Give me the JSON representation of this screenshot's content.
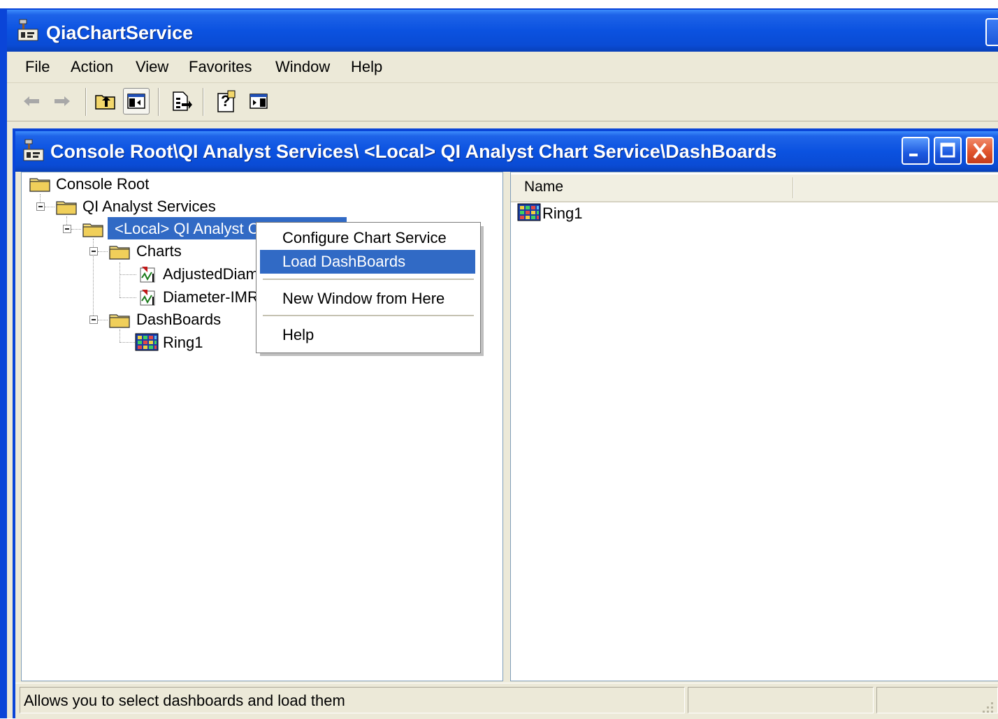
{
  "app": {
    "title": "QiaChartService"
  },
  "menu": [
    {
      "label": "File"
    },
    {
      "label": "Action"
    },
    {
      "label": "View"
    },
    {
      "label": "Favorites"
    },
    {
      "label": "Window"
    },
    {
      "label": "Help"
    }
  ],
  "toolbar": {
    "buttons": [
      "back-arrow-icon",
      "forward-arrow-icon",
      "up-folder-icon",
      "show-hide-tree-icon",
      "export-list-icon",
      "help-icon",
      "show-hide-action-pane-icon"
    ]
  },
  "inner_window": {
    "title": "Console Root\\QI Analyst Services\\ <Local> QI Analyst Chart Service\\DashBoards"
  },
  "tree": {
    "root": "Console Root",
    "services": "QI Analyst Services",
    "local": "<Local> QI Analyst C",
    "charts": "Charts",
    "chart_1": "AdjustedDiam",
    "chart_2": "Diameter-IMR",
    "dashboards": "DashBoards",
    "dashboard_1": "Ring1"
  },
  "list": {
    "column_name": "Name",
    "rows": [
      "Ring1"
    ]
  },
  "context_menu": {
    "item_configure": "Configure Chart Service",
    "item_load": "Load DashBoards",
    "item_new_window": "New Window from Here",
    "item_help": "Help"
  },
  "status": {
    "text": "Allows you to select dashboards and load them"
  },
  "colors": {
    "title_blue": "#0a4bd4",
    "selection_blue": "#316ac5",
    "chrome": "#ece9d8",
    "close_red": "#e0542c"
  }
}
